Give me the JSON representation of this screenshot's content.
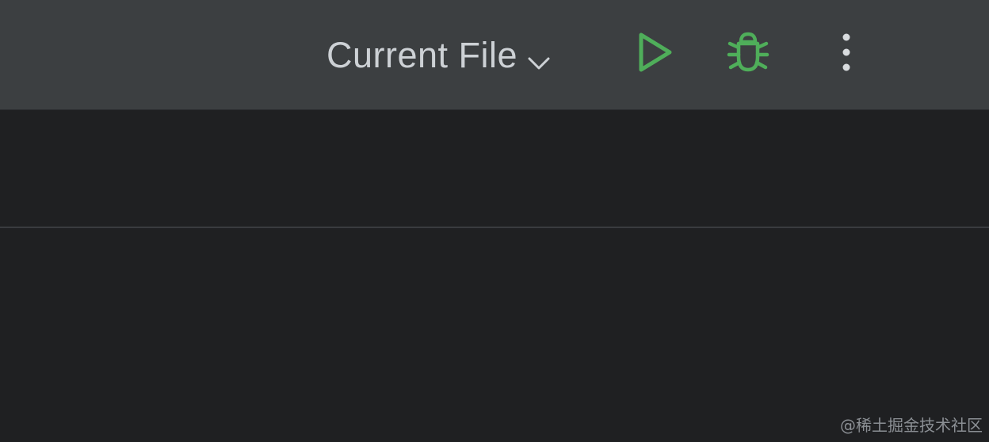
{
  "toolbar": {
    "run_config": {
      "label": "Current File",
      "dropdown_icon": "chevron-down-icon"
    },
    "run_button": {
      "icon": "play-icon",
      "color": "#4fae5a"
    },
    "debug_button": {
      "icon": "bug-icon",
      "color": "#4fae5a"
    },
    "more_button": {
      "icon": "more-vertical-icon",
      "color": "#d9dcdf"
    }
  },
  "colors": {
    "toolbar_bg": "#3c3f41",
    "editor_bg": "#1f2022",
    "text": "#cdd1d5",
    "accent_green": "#4fae5a"
  },
  "watermark": "@稀土掘金技术社区"
}
